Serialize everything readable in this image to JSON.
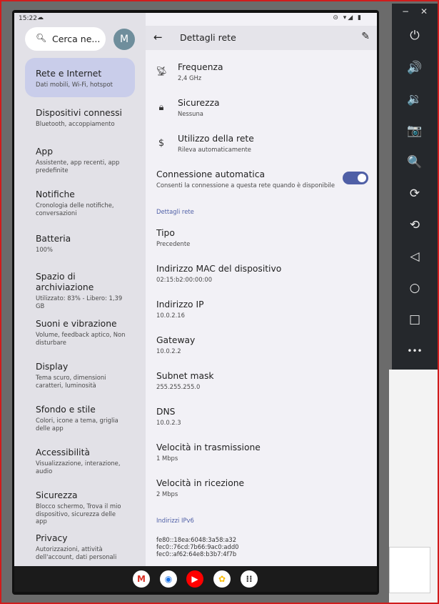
{
  "status_bar": {
    "time": "15:22",
    "right_icons": "⊝ ▾◢ ▮"
  },
  "left": {
    "search_placeholder": "Cerca ne...",
    "avatar_letter": "M",
    "items": [
      {
        "title": "Rete e Internet",
        "subtitle": "Dati mobili, Wi-Fi, hotspot"
      },
      {
        "title": "Dispositivi connessi",
        "subtitle": "Bluetooth, accoppiamento"
      },
      {
        "title": "App",
        "subtitle": "Assistente, app recenti, app predefinite"
      },
      {
        "title": "Notifiche",
        "subtitle": "Cronologia delle notifiche, conversazioni"
      },
      {
        "title": "Batteria",
        "subtitle": "100%"
      },
      {
        "title": "Spazio di archiviazione",
        "subtitle": "Utilizzato: 83% - Libero: 1,39 GB"
      },
      {
        "title": "Suoni e vibrazione",
        "subtitle": "Volume, feedback aptico, Non disturbare"
      },
      {
        "title": "Display",
        "subtitle": "Tema scuro, dimensioni caratteri, luminosità"
      },
      {
        "title": "Sfondo e stile",
        "subtitle": "Colori, icone a tema, griglia delle app"
      },
      {
        "title": "Accessibilità",
        "subtitle": "Visualizzazione, interazione, audio"
      },
      {
        "title": "Sicurezza",
        "subtitle": "Blocco schermo, Trova il mio dispositivo, sicurezza delle app"
      },
      {
        "title": "Privacy",
        "subtitle": "Autorizzazioni, attività dell'account, dati personali"
      }
    ]
  },
  "right": {
    "header_title": "Dettagli rete",
    "icon_rows": [
      {
        "title": "Frequenza",
        "subtitle": "2,4 GHz"
      },
      {
        "title": "Sicurezza",
        "subtitle": "Nessuna"
      },
      {
        "title": "Utilizzo della rete",
        "subtitle": "Rileva automaticamente"
      }
    ],
    "auto_connect": {
      "title": "Connessione automatica",
      "subtitle": "Consenti la connessione a questa rete quando è disponibile",
      "enabled": true
    },
    "section_details": "Dettagli rete",
    "details": [
      {
        "title": "Tipo",
        "value": "Precedente"
      },
      {
        "title": "Indirizzo MAC del dispositivo",
        "value": "02:15:b2:00:00:00"
      },
      {
        "title": "Indirizzo IP",
        "value": "10.0.2.16"
      },
      {
        "title": "Gateway",
        "value": "10.0.2.2"
      },
      {
        "title": "Subnet mask",
        "value": "255.255.255.0"
      },
      {
        "title": "DNS",
        "value": "10.0.2.3"
      },
      {
        "title": "Velocità in trasmissione",
        "value": "1 Mbps"
      },
      {
        "title": "Velocità in ricezione",
        "value": "2 Mbps"
      }
    ],
    "section_ipv6": "Indirizzi IPv6",
    "ipv6": [
      "fe80::18ea:6048:3a58:a32",
      "fec0::76cd:7b66:9ac0:add0",
      "fec0::af62:64e8:b3b7:4f7b"
    ]
  },
  "dock": [
    "M",
    "◉",
    "▶",
    "✿",
    "⁝⁝"
  ],
  "emulator_toolbar": {
    "minimize": "−",
    "close": "✕",
    "buttons": [
      "⏻",
      "🔊",
      "🔉",
      "📷",
      "🔍",
      "⟳",
      "⟲",
      "◁",
      "○",
      "□",
      "•••"
    ]
  }
}
